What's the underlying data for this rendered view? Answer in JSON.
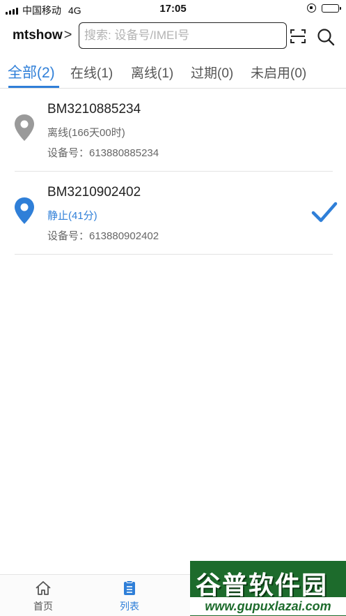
{
  "status_bar": {
    "carrier": "中国移动",
    "network": "4G",
    "time": "17:05",
    "battery_level": 0.45
  },
  "header": {
    "account": "mtshow",
    "account_chevron": ">",
    "search_placeholder": "搜索: 设备号/IMEI号"
  },
  "tabs": [
    {
      "label": "全部(2)",
      "active": true
    },
    {
      "label": "在线(1)",
      "active": false
    },
    {
      "label": "离线(1)",
      "active": false
    },
    {
      "label": "过期(0)",
      "active": false
    },
    {
      "label": "未启用(0)",
      "active": false
    }
  ],
  "devices": [
    {
      "name": "BM3210885234",
      "status": "离线(166天00时)",
      "device_no": "设备号：613880885234",
      "pin_color": "#9a9a9a",
      "status_color": "#666666",
      "selected": false
    },
    {
      "name": "BM3210902402",
      "status": "静止(41分)",
      "device_no": "设备号：613880902402",
      "pin_color": "#2f7fd8",
      "status_color": "#2f7fd8",
      "selected": true
    }
  ],
  "bottom_nav": [
    {
      "label": "首页",
      "icon": "home-icon",
      "active": false
    },
    {
      "label": "列表",
      "icon": "list-icon",
      "active": true
    }
  ],
  "watermark": {
    "title": "谷普软件园",
    "url": "www.gupuxlazai.com"
  },
  "colors": {
    "accent": "#2f7fd8",
    "offline": "#9a9a9a"
  }
}
